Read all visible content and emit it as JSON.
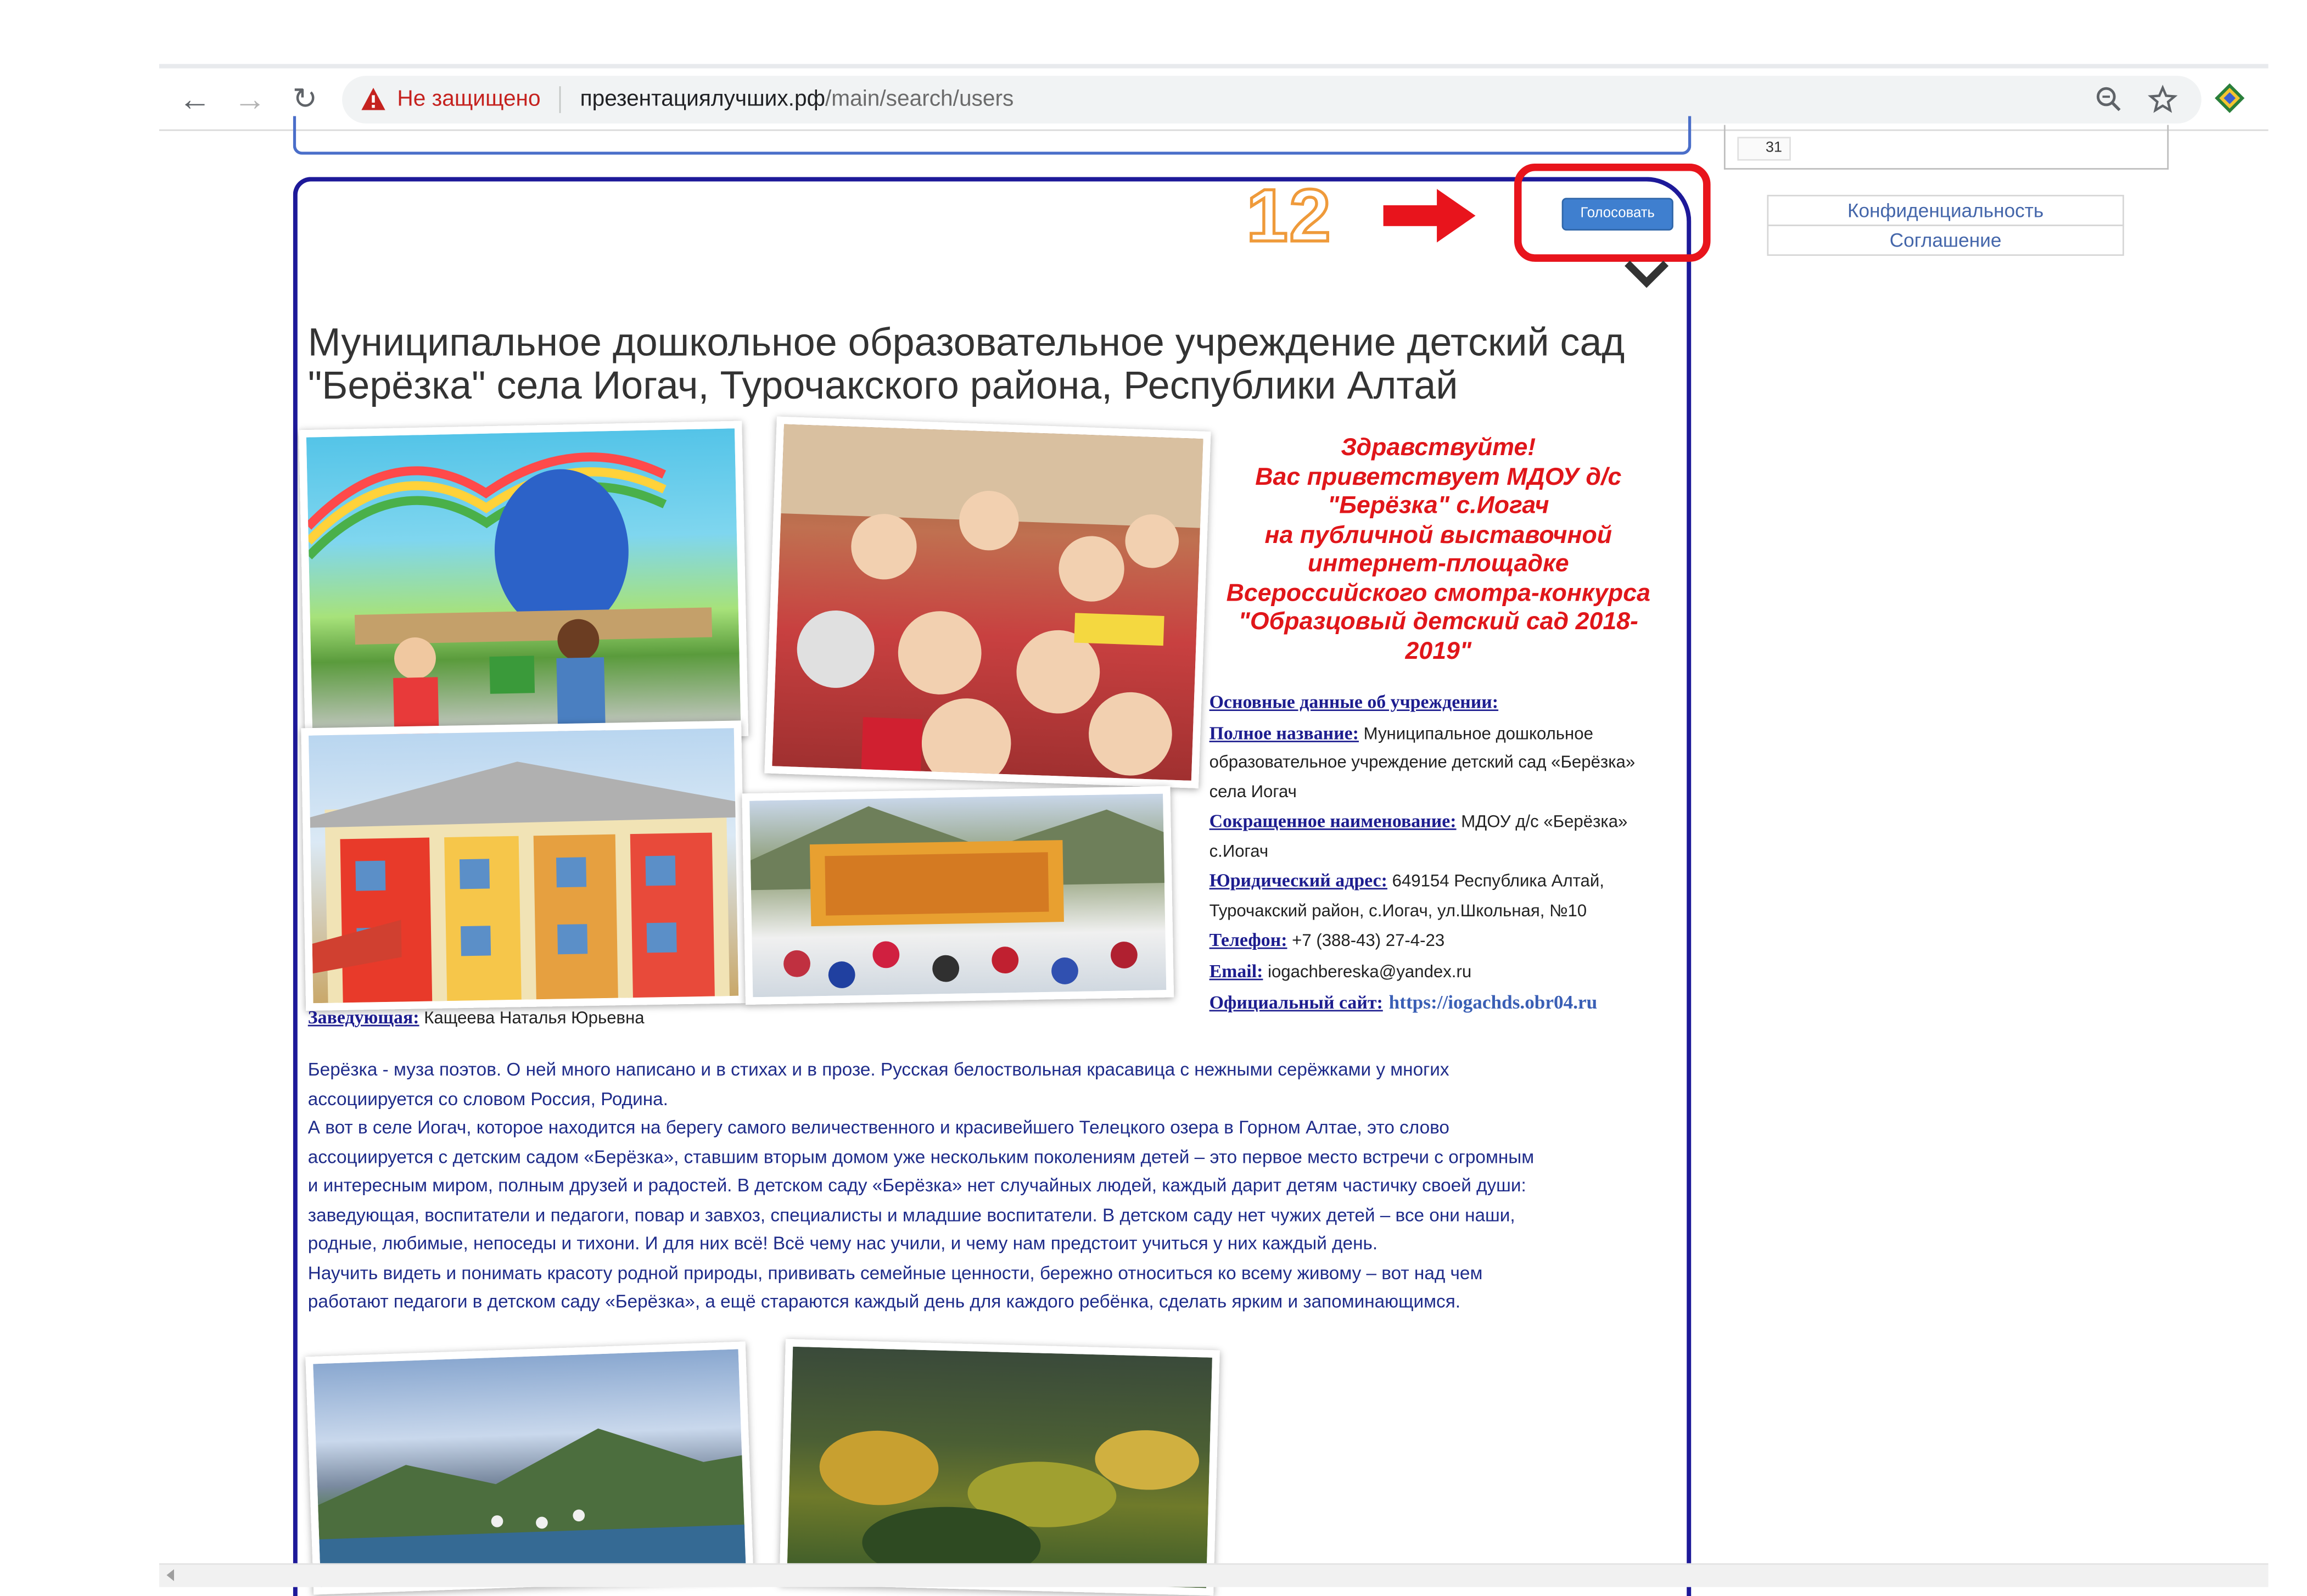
{
  "browser": {
    "security_label": "Не защищено",
    "url_host": "презентациялучших.рф",
    "url_path": "/main/search/users"
  },
  "sidebar": {
    "number_cell": "31",
    "links": [
      "Конфиденциальность",
      "Соглашение"
    ]
  },
  "annotation": {
    "step_number": "12"
  },
  "card": {
    "vote_label": "Голосовать",
    "title_line1": "Муниципальное дошкольное образовательное учреждение детский сад",
    "title_line2": "\"Берёзка\" села Иогач, Турочакского района, Республики Алтай",
    "greeting": [
      "Здравствуйте!",
      "Вас приветствует МДОУ д/с",
      "\"Берёзка\" с.Иогач",
      "на публичной выставочной",
      "интернет-площадке",
      "Всероссийского  смотра-конкурса",
      "\"Образцовый детский сад 2018-",
      "2019\""
    ],
    "info": {
      "basic_label": "Основные данные об учреждении:",
      "full_name_label": "Полное название:",
      "full_name_line1": " Муниципальное дошкольное",
      "full_name_line2": "образовательное учреждение детский сад «Берёзка»",
      "full_name_line3": "села Иогач",
      "short_name_label": "Сокращенное наименование:",
      "short_name_line1": " МДОУ д/с «Берёзка»",
      "short_name_line2": "с.Иогач",
      "address_label": "Юридический адрес:",
      "address_line1": "  649154 Республика Алтай,",
      "address_line2": "Турочакский район, с.Иогач, ул.Школьная, №10",
      "phone_label": "Телефон:",
      "phone_value": " +7 (388-43) 27-4-23",
      "email_label": "Email:",
      "email_value": " iogachbereska@yandex.ru",
      "site_label": "Официальный сайт:",
      "site_value": "https://iogachds.obr04.ru"
    },
    "head_label": "Заведующая:",
    "head_value": " Кащеева Наталья Юрьевна",
    "body_lines": [
      "Берёзка - муза поэтов. О ней много написано и  в стихах и в прозе. Русская белоствольная красавица с нежными серёжками у многих",
      "ассоциируется со словом Россия, Родина.",
      "А вот в  селе Иогач, которое находится на берегу самого величественного и красивейшего Телецкого озера в Горном Алтае,  это слово",
      "ассоциируется  с детским садом «Берёзка», ставшим вторым домом уже нескольким поколениям детей – это первое место встречи с огромным",
      "и интересным миром, полным друзей и радостей. В детском саду «Берёзка» нет случайных людей,  каждый дарит детям частичку своей души:",
      "заведующая, воспитатели и педагоги, повар и завхоз, специалисты и младшие воспитатели. В детском саду нет чужих детей – все они наши,",
      "родные, любимые, непоседы и тихони. И для них всё! Всё  чему нас учили, и чему нам предстоит учиться у них каждый день.",
      "Научить видеть и понимать красоту родной природы, прививать семейные ценности, бережно относиться ко всему живому – вот над чем",
      "работают педагоги в детском саду «Берёзка», а ещё стараются каждый день для каждого ребёнка, сделать  ярким и запоминающимся."
    ]
  },
  "colors": {
    "card_border": "#1d1999",
    "vote_button": "#3f7fcf",
    "annotation_red": "#e8141c",
    "annotation_orange": "#ef9a3a",
    "greeting_red": "#e0161a",
    "body_text": "#1f2c8a"
  },
  "icons": [
    "back-arrow-icon",
    "forward-arrow-icon",
    "reload-icon",
    "warning-icon",
    "zoom-icon",
    "star-icon",
    "extension-icon",
    "chevron-down-icon",
    "red-arrow-icon"
  ]
}
